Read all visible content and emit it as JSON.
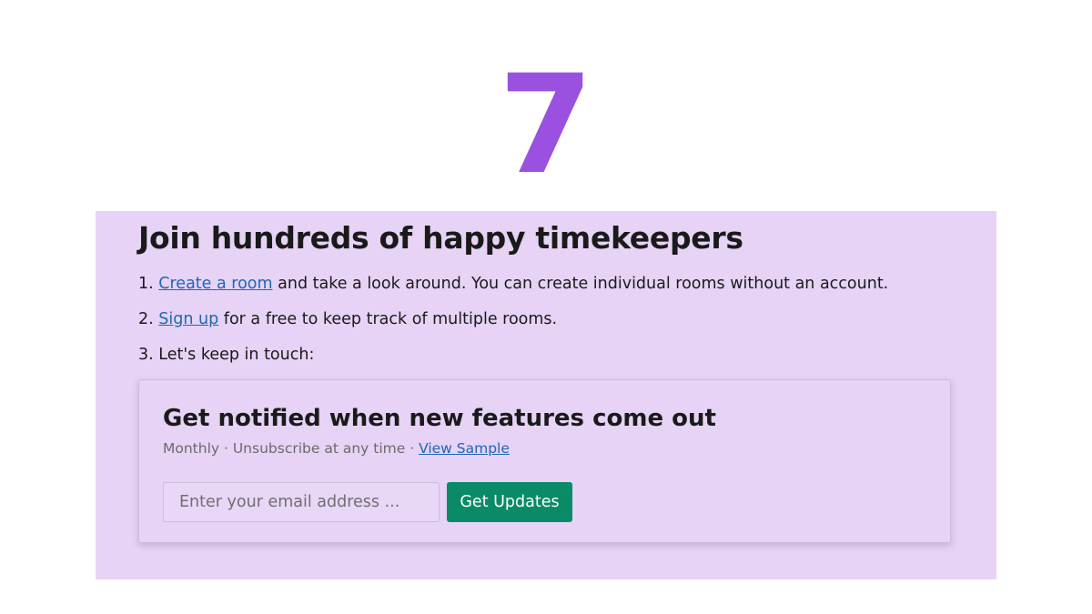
{
  "hero": {
    "number": "7"
  },
  "panel": {
    "title": "Join hundreds of happy timekeepers",
    "steps": [
      {
        "number": "1.",
        "link_text": "Create a room",
        "text": " and take a look around. You can create individual rooms without an account."
      },
      {
        "number": "2.",
        "link_text": "Sign up",
        "text": " for a free to keep track of multiple rooms."
      },
      {
        "number": "3.",
        "text": "Let's keep in touch:"
      }
    ]
  },
  "newsletter": {
    "title": "Get notified when new features come out",
    "frequency": "Monthly · Unsubscribe at any time · ",
    "sample_link": "View Sample",
    "email_placeholder": "Enter your email address ...",
    "email_value": "",
    "button_label": "Get Updates"
  },
  "colors": {
    "accent_purple": "#9b51e0",
    "panel_background": "#e6d3f5",
    "button_green": "#0b8a68",
    "link_blue": "#1f66b8"
  }
}
